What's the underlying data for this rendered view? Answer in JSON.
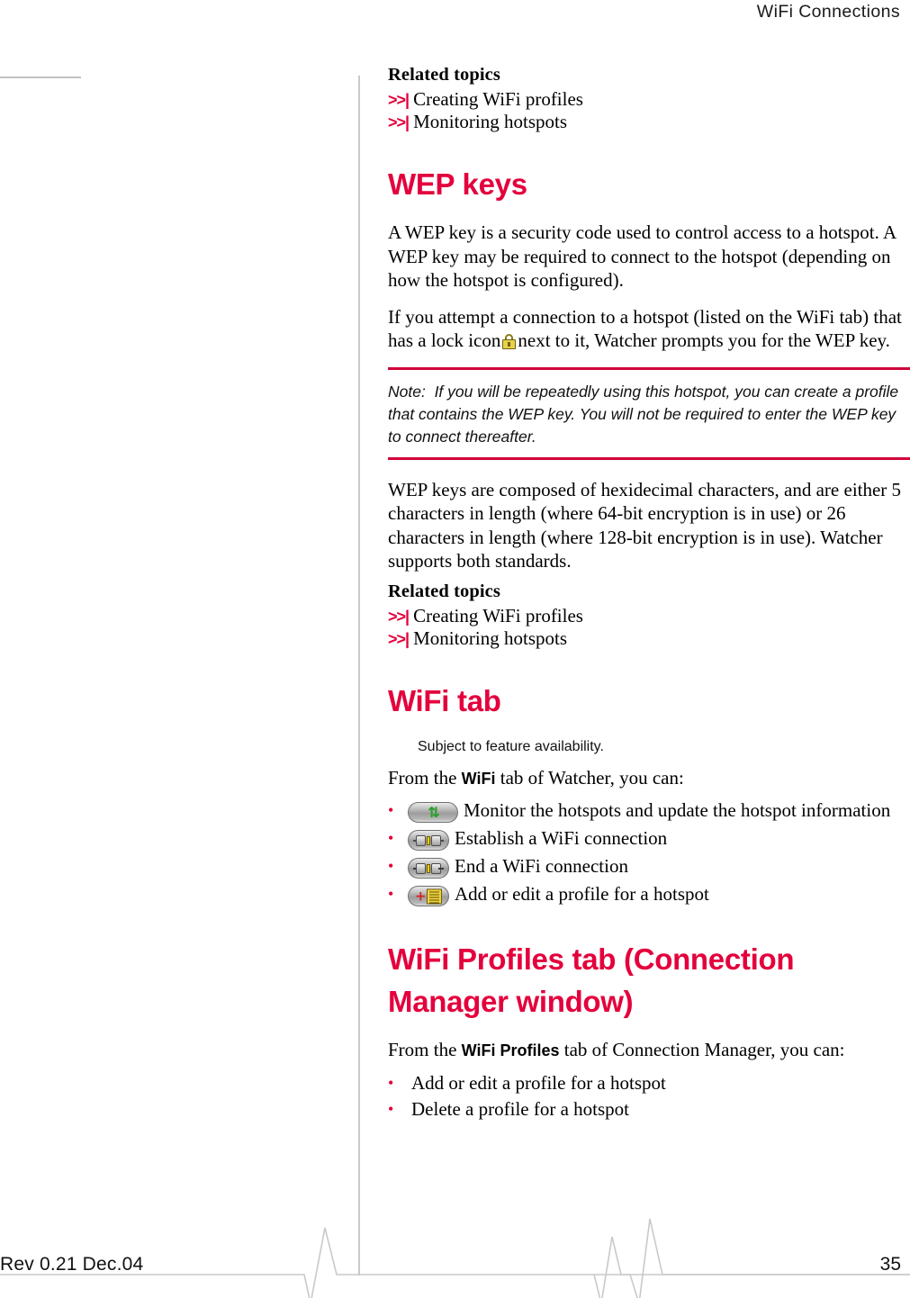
{
  "header": {
    "running_head": "WiFi Connections"
  },
  "sections": {
    "related_topics_1": {
      "heading": "Related topics",
      "links": [
        {
          "marker": ">>|",
          "label": "Creating WiFi profiles"
        },
        {
          "marker": ">>|",
          "label": "Monitoring hotspots"
        }
      ]
    },
    "wep_keys": {
      "heading": "WEP keys",
      "para1": "A WEP key is a security code used to control access to a hotspot. A WEP key may be required to connect to the hotspot (depending on how the hotspot is configured).",
      "para2_before_icon": "If you attempt a connection to a hotspot (listed on the WiFi tab) that has a lock icon",
      "para2_after_icon": "next to it, Watcher prompts you for the WEP key.",
      "note": {
        "label": "Note:",
        "text": "If you will be repeatedly using this hotspot, you can create a profile that contains the WEP key. You will not be required to enter the WEP key to connect thereafter."
      },
      "para3": "WEP keys are composed of hexidecimal characters, and are either 5 characters in length (where 64-bit encryption is in use) or 26 characters in length (where 128-bit encryption is in use). Watcher supports both standards."
    },
    "related_topics_2": {
      "heading": "Related topics",
      "links": [
        {
          "marker": ">>|",
          "label": "Creating WiFi profiles"
        },
        {
          "marker": ">>|",
          "label": "Monitoring hotspots"
        }
      ]
    },
    "wifi_tab": {
      "heading": "WiFi tab",
      "feature_note": "Subject to feature availability.",
      "intro_before": "From the",
      "intro_term": "WiFi",
      "intro_after": "tab of Watcher, you can:",
      "items": [
        {
          "icon": "refresh-icon",
          "label": "Monitor the hotspots and update the hotspot information"
        },
        {
          "icon": "connect-plug-icon",
          "label": "Establish a WiFi connection"
        },
        {
          "icon": "disconnect-plug-icon",
          "label": "End a WiFi connection"
        },
        {
          "icon": "add-profile-icon",
          "label": "Add or edit a profile for a hotspot"
        }
      ]
    },
    "wifi_profiles_tab": {
      "heading": "WiFi Profiles tab (Connection Manager window)",
      "intro_before": "From the",
      "intro_term": "WiFi Profiles",
      "intro_after": "tab of Connection Manager, you can:",
      "items": [
        {
          "label": "Add or edit a profile for a hotspot"
        },
        {
          "label": "Delete a profile for a hotspot"
        }
      ]
    }
  },
  "footer": {
    "revision": "Rev 0.21  Dec.04",
    "page_number": "35"
  },
  "colors": {
    "accent_red": "#e4003c",
    "note_rule": "#d1003a",
    "divider_gray": "#c9c9c9",
    "lock_gold": "#e8d24a"
  }
}
